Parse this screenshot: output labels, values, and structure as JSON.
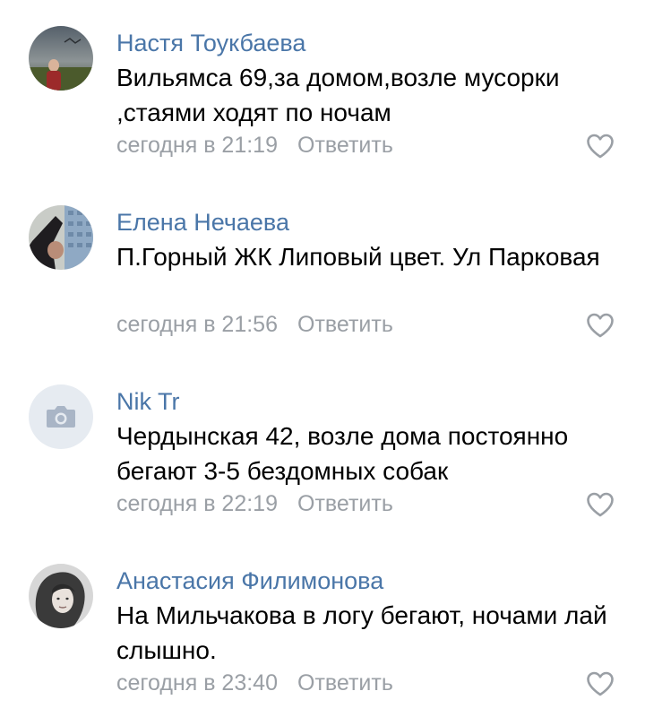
{
  "colors": {
    "author_name": "#4a76a8",
    "meta_text": "#9a9fa5",
    "comment_text": "#000000",
    "like_icon": "#9a9fa5",
    "avatar_placeholder_bg": "#e6ebf1",
    "avatar_placeholder_icon": "#a9b5c6"
  },
  "comments": [
    {
      "author": "Настя Тоукбаева",
      "text": "Вильямса 69,за домом,возле мусорки ,стаями ходят по ночам",
      "time": "сегодня в 21:19",
      "reply_label": "Ответить",
      "avatar_icon": "user-photo-avatar",
      "like_icon": "heart-outline-icon"
    },
    {
      "author": "Елена Нечаева",
      "text": "П.Горный ЖК Липовый цвет. Ул Парковая",
      "time": "сегодня в 21:56",
      "reply_label": "Ответить",
      "avatar_icon": "user-photo-avatar",
      "like_icon": "heart-outline-icon"
    },
    {
      "author": "Nik Tr",
      "text": "Чердынская 42, возле дома постоянно бегают 3-5 бездомных собак",
      "time": "сегодня в 22:19",
      "reply_label": "Ответить",
      "avatar_icon": "camera-placeholder-icon",
      "like_icon": "heart-outline-icon"
    },
    {
      "author": "Анастасия Филимонова",
      "text": "На Мильчакова в логу бегают, ночами лай слышно.",
      "time": "сегодня в 23:40",
      "reply_label": "Ответить",
      "avatar_icon": "user-photo-avatar",
      "like_icon": "heart-outline-icon"
    }
  ]
}
